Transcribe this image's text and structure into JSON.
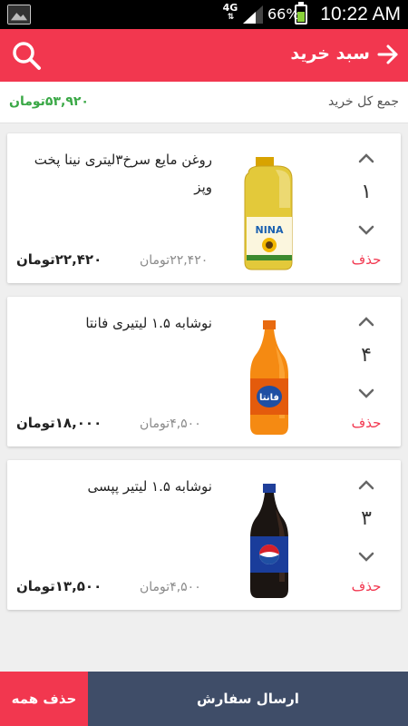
{
  "status_bar": {
    "network": "4G",
    "battery_percent": "66%",
    "battery_level": 0.66,
    "time": "10:22 AM"
  },
  "header": {
    "title": "سبد خرید",
    "icons": {
      "search": "search-icon",
      "back": "arrow-right-icon"
    }
  },
  "summary": {
    "total_label": "جمع کل خرید",
    "total_value": "۵۳,۹۲۰تومان"
  },
  "cart": {
    "items": [
      {
        "title": "روغن مایع سرخ۳لیتری نینا  پخت وپز",
        "quantity": "۱",
        "unit_price": "۲۲,۴۲۰تومان",
        "line_total": "۲۲,۴۲۰تومان",
        "delete_label": "حذف",
        "image": "oil-bottle-image"
      },
      {
        "title": "نوشابه ۱.۵ لیتیری فانتا",
        "quantity": "۴",
        "unit_price": "۴,۵۰۰تومان",
        "line_total": "۱۸,۰۰۰تومان",
        "delete_label": "حذف",
        "image": "fanta-bottle-image"
      },
      {
        "title": "نوشابه ۱.۵ لیتیر پپسی",
        "quantity": "۳",
        "unit_price": "۴,۵۰۰تومان",
        "line_total": "۱۳,۵۰۰تومان",
        "delete_label": "حذف",
        "image": "pepsi-bottle-image"
      }
    ]
  },
  "actions": {
    "delete_all": "حذف همه",
    "send_order": "ارسال سفارش"
  },
  "colors": {
    "accent": "#f2374f",
    "send_button": "#3f4d68",
    "total_green": "#3aa846"
  }
}
